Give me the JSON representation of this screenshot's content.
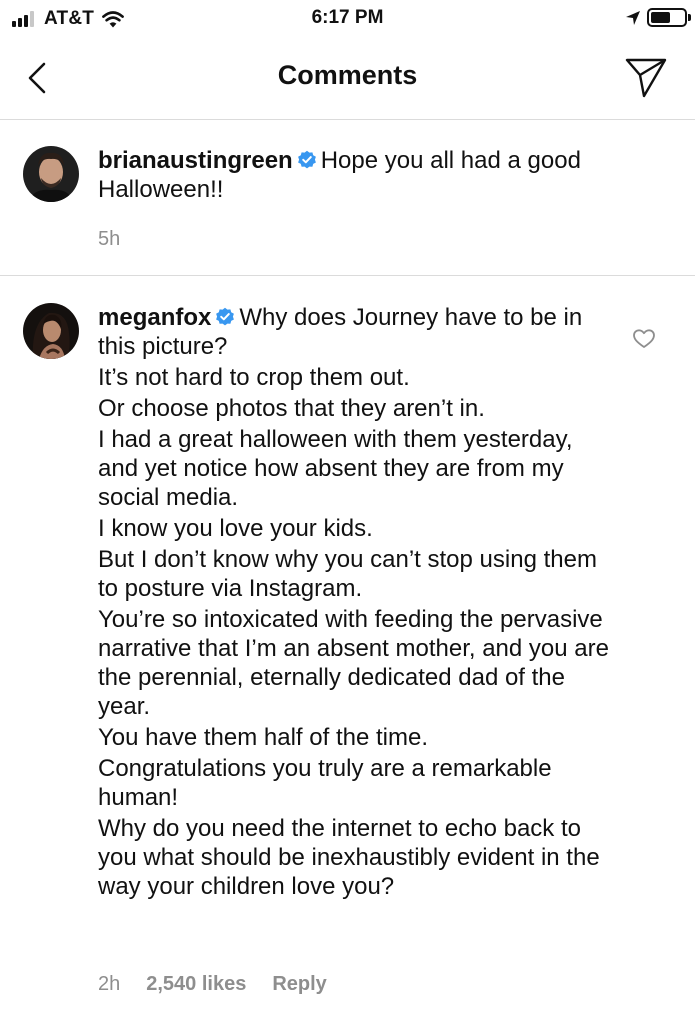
{
  "status_bar": {
    "carrier": "AT&T",
    "time": "6:17 PM",
    "battery_level": 0.6
  },
  "header": {
    "title": "Comments"
  },
  "caption": {
    "username": "brianaustingreen",
    "text": "Hope you all had a good Halloween!!",
    "time": "5h"
  },
  "comments": [
    {
      "username": "meganfox",
      "paragraphs": [
        "Why does Journey have to be in this picture?",
        "It’s not hard to crop them out.",
        "Or choose photos that they aren’t in.",
        "I had a great halloween with them yesterday, and yet notice how absent they are from my social media.",
        "I know you love your kids.",
        "But I don’t know why you can’t stop using them to posture via Instagram.",
        "You’re so intoxicated with feeding the pervasive narrative that I’m an absent mother, and you are the perennial, eternally dedicated dad of the year.",
        "You have them half of the time.",
        "Congratulations you truly are a remarkable human!",
        "Why do you need the internet to echo back to you what should be inexhaustibly evident in the way your children love you?"
      ],
      "time": "2h",
      "likes": "2,540 likes",
      "reply_label": "Reply"
    }
  ],
  "colors": {
    "verified_badge": "#3897f0",
    "meta_text": "#8e8e8e",
    "divider": "#dbdbdb"
  },
  "icons": {
    "back": "chevron-left-icon",
    "send": "paper-plane-icon",
    "verified": "verified-badge-icon",
    "like": "heart-outline-icon"
  }
}
